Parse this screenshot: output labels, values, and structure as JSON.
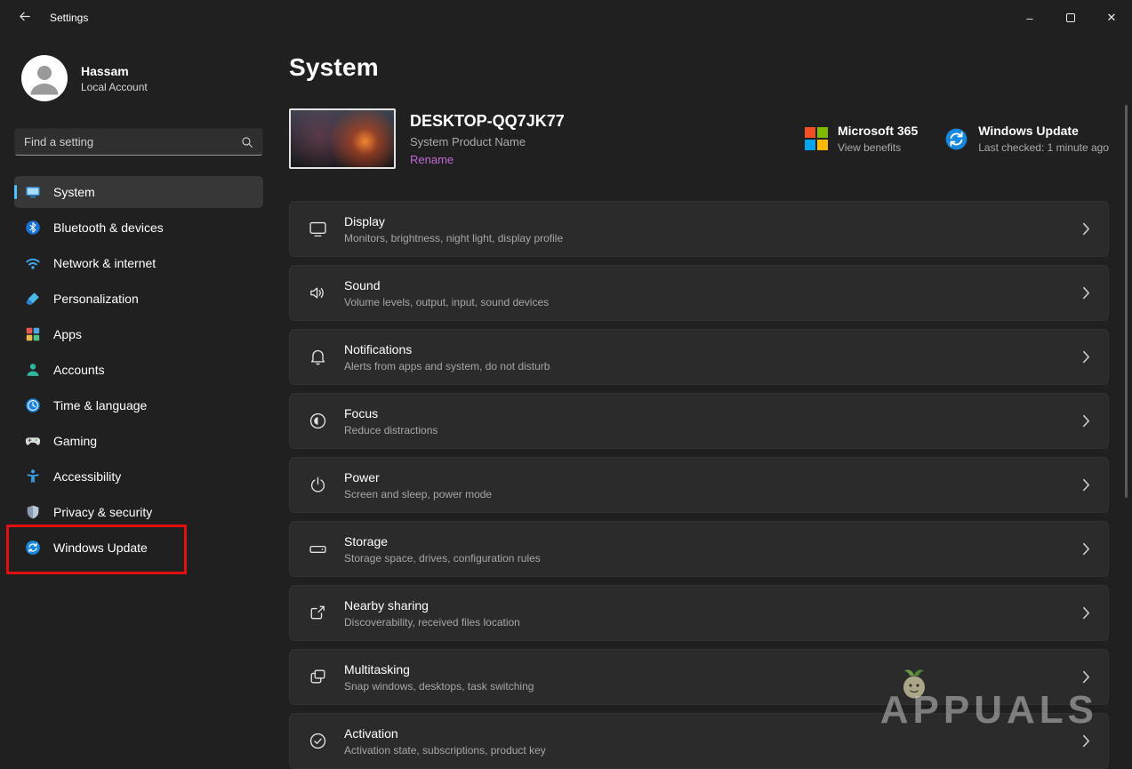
{
  "colors": {
    "page_background": "#202020",
    "card_background": "#2b2b2b",
    "accent_blue": "#4cc2ff",
    "link_purple": "#c06ad4",
    "annotation_red": "#e30e0e"
  },
  "titlebar": {
    "title": "Settings",
    "minimize_glyph": "–",
    "close_glyph": "✕"
  },
  "sidebar": {
    "user": {
      "name": "Hassam",
      "account_type": "Local Account"
    },
    "search": {
      "placeholder": "Find a setting"
    },
    "items": [
      {
        "label": "System",
        "icon": "system-icon",
        "selected": true
      },
      {
        "label": "Bluetooth & devices",
        "icon": "bluetooth-icon",
        "selected": false
      },
      {
        "label": "Network & internet",
        "icon": "network-icon",
        "selected": false
      },
      {
        "label": "Personalization",
        "icon": "personalization-icon",
        "selected": false
      },
      {
        "label": "Apps",
        "icon": "apps-icon",
        "selected": false
      },
      {
        "label": "Accounts",
        "icon": "accounts-icon",
        "selected": false
      },
      {
        "label": "Time & language",
        "icon": "time-language-icon",
        "selected": false
      },
      {
        "label": "Gaming",
        "icon": "gaming-icon",
        "selected": false
      },
      {
        "label": "Accessibility",
        "icon": "accessibility-icon",
        "selected": false
      },
      {
        "label": "Privacy & security",
        "icon": "privacy-security-icon",
        "selected": false
      },
      {
        "label": "Windows Update",
        "icon": "windows-update-icon",
        "selected": false,
        "annotated": true
      }
    ]
  },
  "main": {
    "page_title": "System",
    "device": {
      "name": "DESKTOP-QQ7JK77",
      "product_name": "System Product Name",
      "rename_label": "Rename"
    },
    "quick_links": [
      {
        "title": "Microsoft 365",
        "subtitle": "View benefits",
        "icon": "microsoft-365-icon"
      },
      {
        "title": "Windows Update",
        "subtitle": "Last checked: 1 minute ago",
        "icon": "windows-update-icon"
      }
    ],
    "cards": [
      {
        "title": "Display",
        "subtitle": "Monitors, brightness, night light, display profile",
        "icon": "display-icon"
      },
      {
        "title": "Sound",
        "subtitle": "Volume levels, output, input, sound devices",
        "icon": "sound-icon"
      },
      {
        "title": "Notifications",
        "subtitle": "Alerts from apps and system, do not disturb",
        "icon": "notifications-icon"
      },
      {
        "title": "Focus",
        "subtitle": "Reduce distractions",
        "icon": "focus-icon"
      },
      {
        "title": "Power",
        "subtitle": "Screen and sleep, power mode",
        "icon": "power-icon"
      },
      {
        "title": "Storage",
        "subtitle": "Storage space, drives, configuration rules",
        "icon": "storage-icon"
      },
      {
        "title": "Nearby sharing",
        "subtitle": "Discoverability, received files location",
        "icon": "nearby-sharing-icon"
      },
      {
        "title": "Multitasking",
        "subtitle": "Snap windows, desktops, task switching",
        "icon": "multitasking-icon"
      },
      {
        "title": "Activation",
        "subtitle": "Activation state, subscriptions, product key",
        "icon": "activation-icon"
      }
    ]
  },
  "watermark": {
    "text": "APPUALS"
  }
}
